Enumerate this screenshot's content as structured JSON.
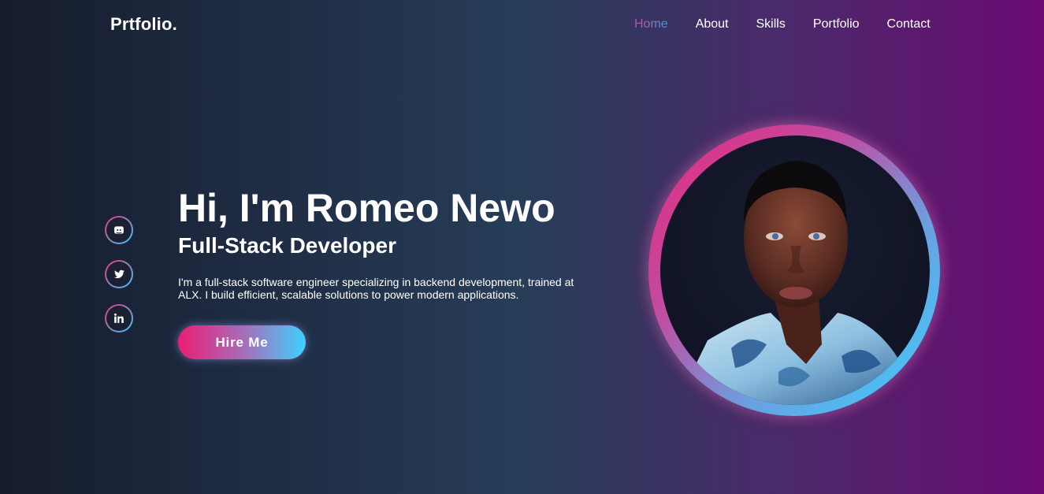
{
  "header": {
    "logo": "Prtfolio.",
    "nav": [
      {
        "label": "Home",
        "active": true
      },
      {
        "label": "About",
        "active": false
      },
      {
        "label": "Skills",
        "active": false
      },
      {
        "label": "Portfolio",
        "active": false
      },
      {
        "label": "Contact",
        "active": false
      }
    ]
  },
  "socials": [
    {
      "icon": "discord-icon"
    },
    {
      "icon": "twitter-icon"
    },
    {
      "icon": "linkedin-icon"
    }
  ],
  "hero": {
    "greeting": "Hi, I'm Romeo Newo",
    "role": "Full-Stack Developer",
    "description": "I'm a full-stack software engineer specializing in backend development, trained at ALX. I build efficient, scalable solutions to power modern applications.",
    "cta_label": "Hire Me"
  },
  "colors": {
    "accent_pink": "#ea1e74",
    "accent_blue": "#3fd0ff",
    "bg_dark": "#161d2c",
    "bg_purple": "#6a0a72"
  }
}
